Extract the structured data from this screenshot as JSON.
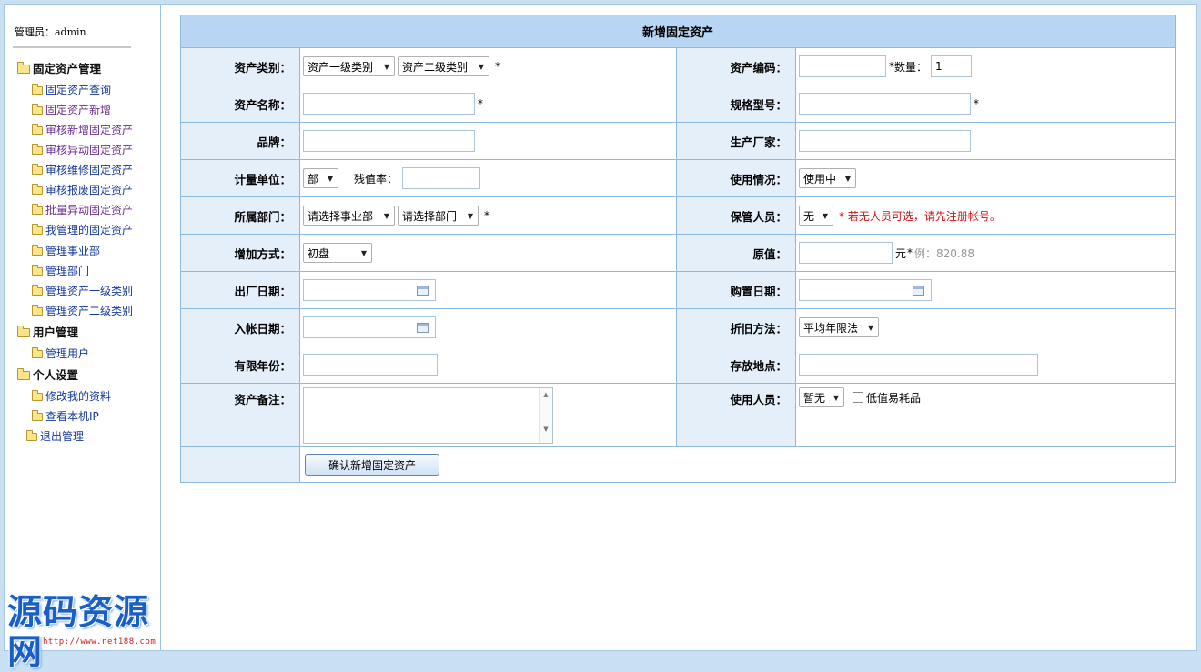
{
  "sidebar": {
    "admin_label": "管理员：admin",
    "groups": [
      {
        "label": "固定资产管理",
        "items": [
          "固定资产查询",
          "固定资产新增",
          "审核新增固定资产",
          "审核异动固定资产",
          "审核维修固定资产",
          "审核报废固定资产",
          "批量异动固定资产",
          "我管理的固定资产",
          "管理事业部",
          "管理部门",
          "管理资产一级类别",
          "管理资产二级类别"
        ]
      },
      {
        "label": "用户管理",
        "items": [
          "管理用户"
        ]
      },
      {
        "label": "个人设置",
        "items": [
          "修改我的资料",
          "查看本机IP"
        ]
      }
    ],
    "logout": "退出管理",
    "logo_text": "源码资源网",
    "logo_url": "http://www.net188.com"
  },
  "form": {
    "title": "新增固定资产",
    "asset_category": {
      "label": "资产类别：",
      "level1": "资产一级类别",
      "level2": "资产二级类别",
      "required": "*"
    },
    "asset_code": {
      "label": "资产编码：",
      "value": "",
      "required": "*",
      "qty_label": "数量：",
      "qty_value": "1"
    },
    "asset_name": {
      "label": "资产名称：",
      "value": "",
      "required": "*"
    },
    "spec_model": {
      "label": "规格型号：",
      "value": "",
      "required": "*"
    },
    "brand": {
      "label": "品牌：",
      "value": ""
    },
    "manufacturer": {
      "label": "生产厂家：",
      "value": ""
    },
    "unit": {
      "label": "计量单位：",
      "value": "部",
      "residual_label": "残值率：",
      "residual_value": ""
    },
    "usage_status": {
      "label": "使用情况：",
      "value": "使用中"
    },
    "department": {
      "label": "所属部门：",
      "division": "请选择事业部",
      "dept": "请选择部门",
      "required": "*"
    },
    "custodian": {
      "label": "保管人员：",
      "value": "无",
      "hint": "* 若无人员可选，请先注册帐号。"
    },
    "add_method": {
      "label": "增加方式：",
      "value": "初盘"
    },
    "original_value": {
      "label": "原值：",
      "value": "",
      "unit": "元",
      "required": "*",
      "hint": "例：820.88"
    },
    "factory_date": {
      "label": "出厂日期：",
      "value": ""
    },
    "purchase_date": {
      "label": "购置日期：",
      "value": ""
    },
    "account_date": {
      "label": "入帐日期：",
      "value": ""
    },
    "depreciation": {
      "label": "折旧方法：",
      "value": "平均年限法"
    },
    "useful_years": {
      "label": "有限年份：",
      "value": ""
    },
    "location": {
      "label": "存放地点：",
      "value": ""
    },
    "remark": {
      "label": "资产备注：",
      "value": ""
    },
    "user": {
      "label": "使用人员：",
      "value": "暂无",
      "consumable_label": "低值易耗品"
    },
    "submit_label": "确认新增固定资产"
  }
}
